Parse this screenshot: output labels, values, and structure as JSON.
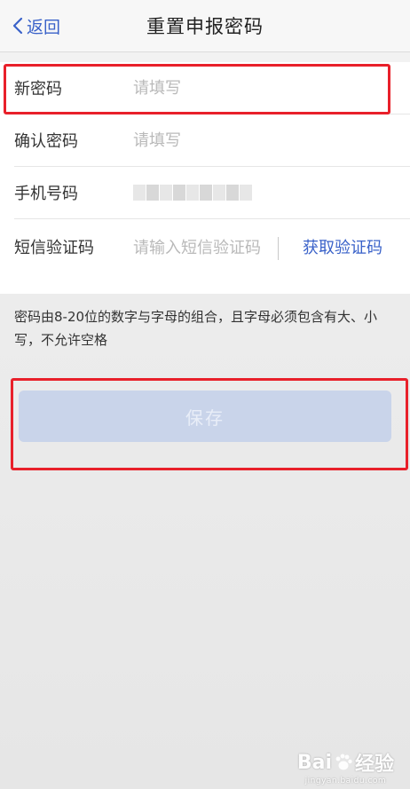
{
  "nav": {
    "back_label": "返回",
    "title": "重置申报密码"
  },
  "form": {
    "new_password": {
      "label": "新密码",
      "placeholder": "请填写"
    },
    "confirm_password": {
      "label": "确认密码",
      "placeholder": "请填写"
    },
    "phone": {
      "label": "手机号码"
    },
    "sms_code": {
      "label": "短信验证码",
      "placeholder": "请输入短信验证码",
      "action": "获取验证码"
    }
  },
  "hint": "密码由8-20位的数字与字母的组合，且字母必须包含有大、小写，不允许空格",
  "save_label": "保存",
  "watermark": {
    "brand_left": "Bai",
    "brand_right": "经验",
    "site": "jingyan.baidu.com"
  },
  "colors": {
    "accent": "#3a62c9",
    "save_disabled": "#c9d4ea",
    "highlight": "#e8202a"
  }
}
